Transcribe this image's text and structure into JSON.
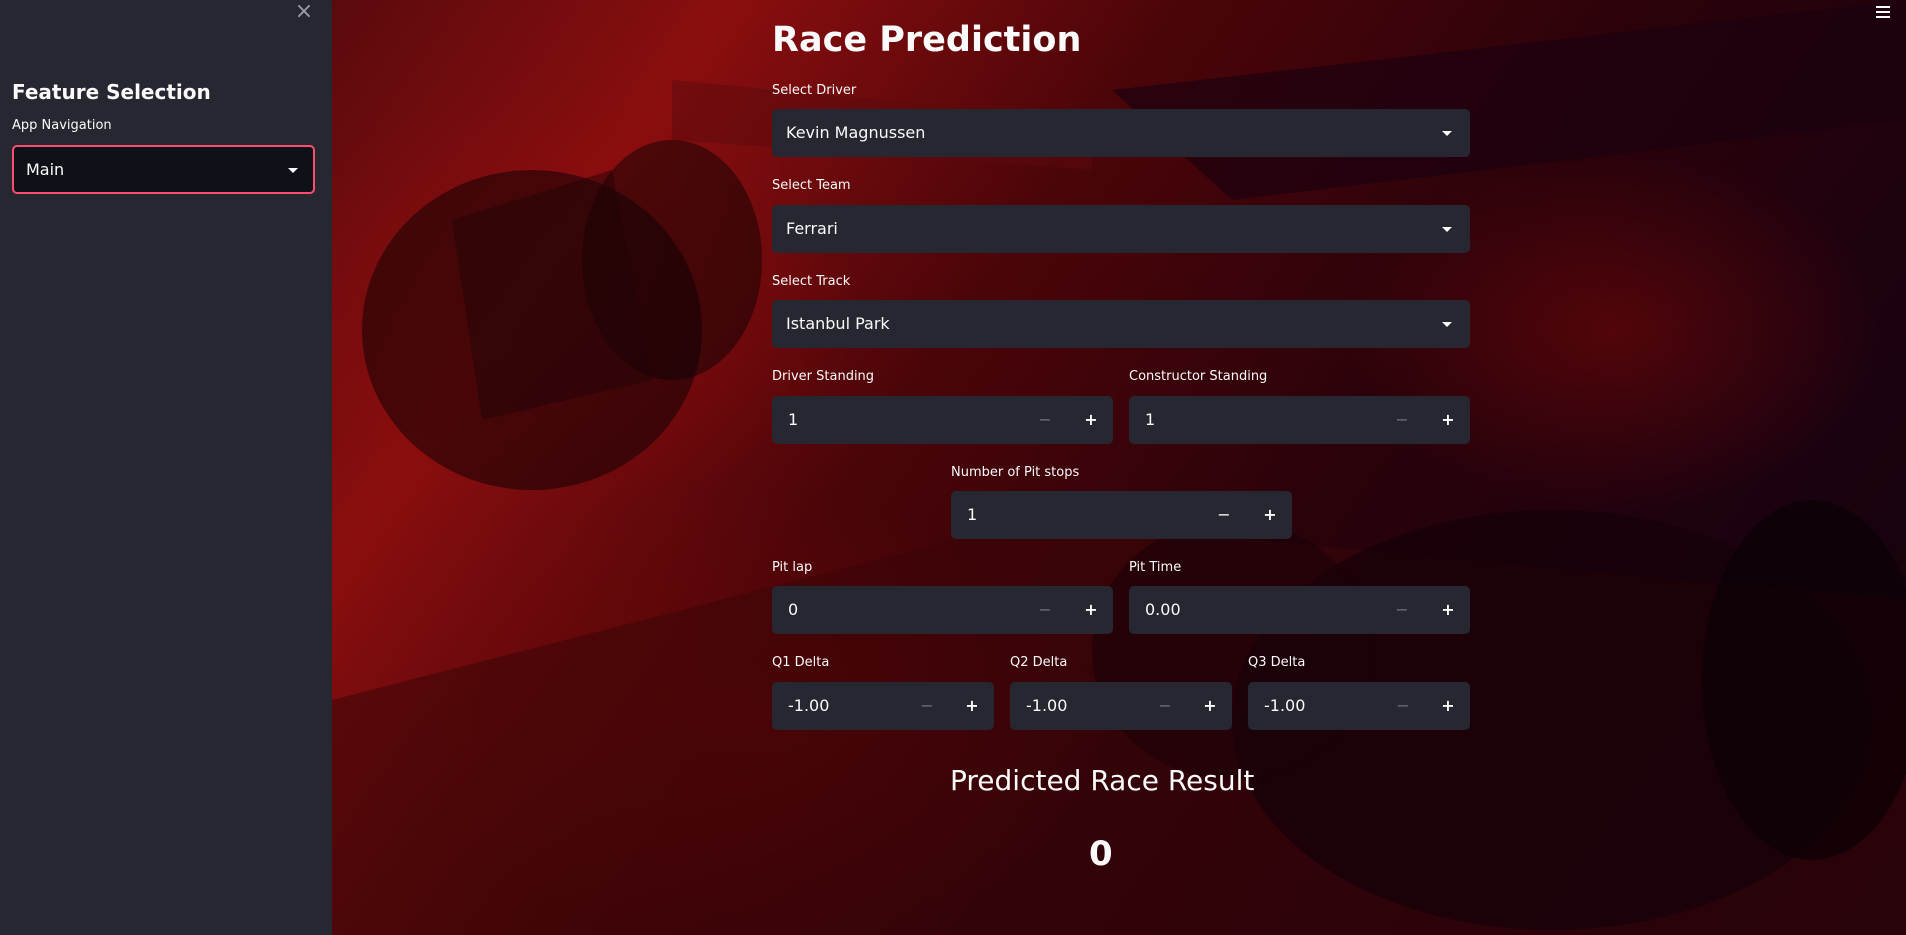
{
  "sidebar": {
    "close_icon": "close-icon",
    "heading": "Feature Selection",
    "nav_label": "App Navigation",
    "nav_value": "Main",
    "accent_color": "#ff4b6e"
  },
  "header": {
    "menu_icon": "hamburger-menu-icon"
  },
  "main": {
    "title": "Race Prediction",
    "driver": {
      "label": "Select Driver",
      "value": "Kevin Magnussen"
    },
    "team": {
      "label": "Select Team",
      "value": "Ferrari"
    },
    "track": {
      "label": "Select Track",
      "value": "Istanbul Park"
    },
    "driver_standing": {
      "label": "Driver Standing",
      "value": "1"
    },
    "constructor_standing": {
      "label": "Constructor Standing",
      "value": "1"
    },
    "pit_stops": {
      "label": "Number of Pit stops",
      "value": "1"
    },
    "pit_lap": {
      "label": "Pit lap",
      "value": "0"
    },
    "pit_time": {
      "label": "Pit Time",
      "value": "0.00"
    },
    "q1_delta": {
      "label": "Q1 Delta",
      "value": "-1.00"
    },
    "q2_delta": {
      "label": "Q2 Delta",
      "value": "-1.00"
    },
    "q3_delta": {
      "label": "Q3 Delta",
      "value": "-1.00"
    },
    "stepper": {
      "minus": "−",
      "plus": "+"
    },
    "result_heading": "Predicted Race Result",
    "result_value": "0"
  },
  "colors": {
    "sidebar_bg": "#262730",
    "input_bg": "#262730",
    "text": "#fafafa",
    "background_tint": "#8a0e0f"
  }
}
